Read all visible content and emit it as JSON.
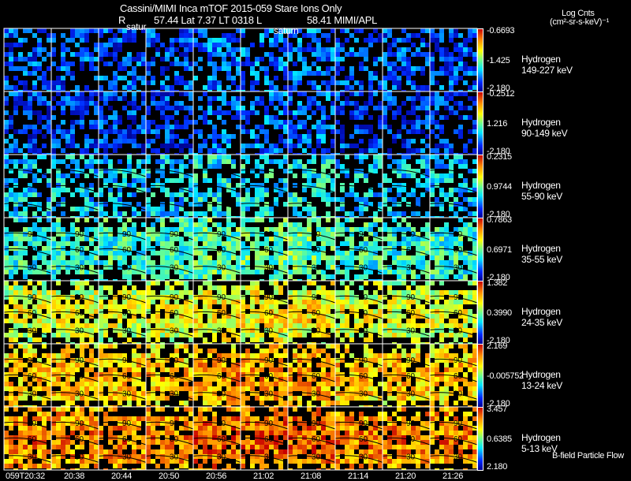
{
  "chart_data": {
    "type": "heatmap",
    "title": "Cassini/MIMI Inca mTOF  2015-059    Stare    Ions Only",
    "subtitle": {
      "r_label": "R",
      "position": "57.44 Lat 7.37 LT 0318 L",
      "l_value": "58.41  MIMI/APL"
    },
    "colorbar_title": "Log Cnts",
    "colorbar_units": "(cm²-sr-s-keV)⁻¹",
    "annotations": [
      "satur",
      "saturn"
    ],
    "footer_note": "B-field Particle Flow",
    "time_labels": [
      "059T20:32",
      "20:38",
      "20:44",
      "20:50",
      "20:56",
      "21:02",
      "21:08",
      "21:14",
      "21:20",
      "21:26"
    ],
    "contour_labels": [
      "90",
      "60",
      "30"
    ],
    "rows": [
      {
        "species": "Hydrogen",
        "energy": "149-227 keV",
        "cbar_max": "-0.6693",
        "cbar_mid": "-1.425",
        "cbar_min": "-2.180",
        "mean_level": 0.18
      },
      {
        "species": "Hydrogen",
        "energy": "90-149 keV",
        "cbar_max": "-0.2512",
        "cbar_mid": "1.216",
        "cbar_min": "-2.180",
        "mean_level": 0.16
      },
      {
        "species": "Hydrogen",
        "energy": "55-90 keV",
        "cbar_max": "0.2315",
        "cbar_mid": "0.9744",
        "cbar_min": "-2.180",
        "mean_level": 0.33
      },
      {
        "species": "Hydrogen",
        "energy": "35-55 keV",
        "cbar_max": "0.7863",
        "cbar_mid": "0.6971",
        "cbar_min": "-2.180",
        "mean_level": 0.42
      },
      {
        "species": "Hydrogen",
        "energy": "24-35 keV",
        "cbar_max": "1.382",
        "cbar_mid": "0.3990",
        "cbar_min": "-2.180",
        "mean_level": 0.55
      },
      {
        "species": "Hydrogen",
        "energy": "13-24 keV",
        "cbar_max": "2.169",
        "cbar_mid": "-0.005752",
        "cbar_min": "-2.180",
        "mean_level": 0.66
      },
      {
        "species": "Hydrogen",
        "energy": "5-13 keV",
        "cbar_max": "3.457",
        "cbar_mid": "0.6385",
        "cbar_min": "2.180",
        "mean_level": 0.74
      }
    ]
  }
}
